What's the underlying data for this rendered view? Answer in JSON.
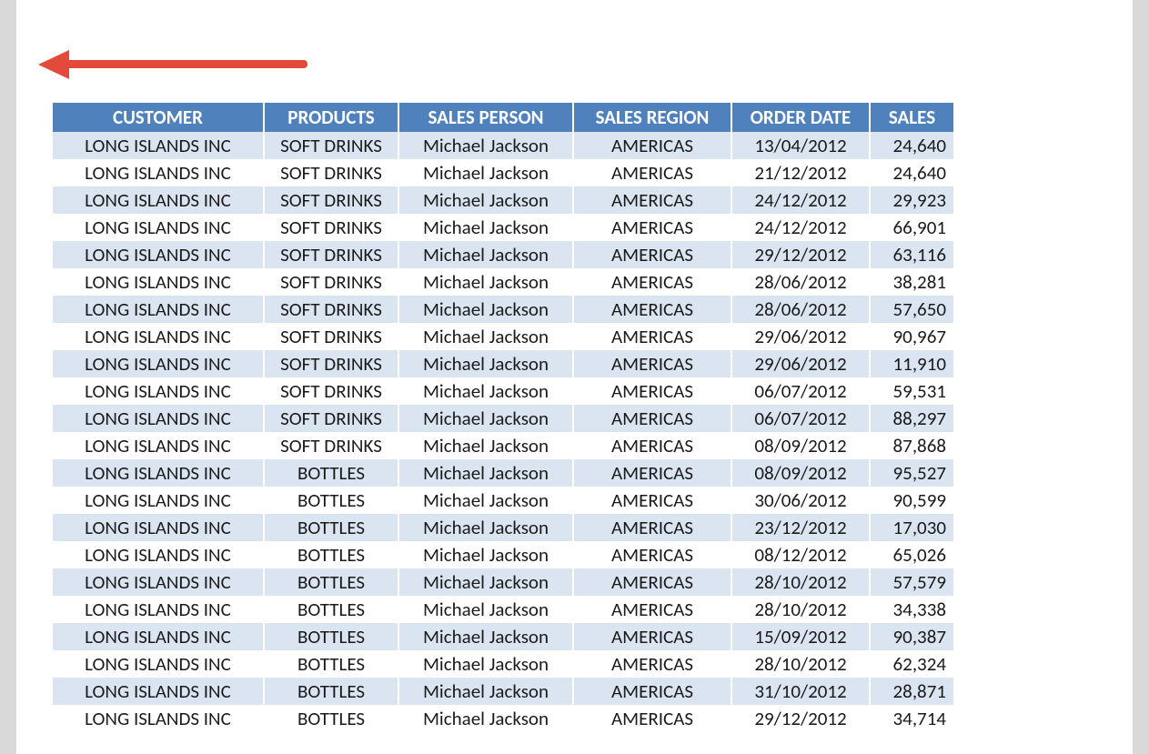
{
  "table": {
    "headers": [
      "CUSTOMER",
      "PRODUCTS",
      "SALES PERSON",
      "SALES REGION",
      "ORDER DATE",
      "SALES"
    ],
    "rows": [
      {
        "customer": "LONG ISLANDS INC",
        "product": "SOFT DRINKS",
        "person": "Michael Jackson",
        "region": "AMERICAS",
        "date": "13/04/2012",
        "sales": "24,640"
      },
      {
        "customer": "LONG ISLANDS INC",
        "product": "SOFT DRINKS",
        "person": "Michael Jackson",
        "region": "AMERICAS",
        "date": "21/12/2012",
        "sales": "24,640"
      },
      {
        "customer": "LONG ISLANDS INC",
        "product": "SOFT DRINKS",
        "person": "Michael Jackson",
        "region": "AMERICAS",
        "date": "24/12/2012",
        "sales": "29,923"
      },
      {
        "customer": "LONG ISLANDS INC",
        "product": "SOFT DRINKS",
        "person": "Michael Jackson",
        "region": "AMERICAS",
        "date": "24/12/2012",
        "sales": "66,901"
      },
      {
        "customer": "LONG ISLANDS INC",
        "product": "SOFT DRINKS",
        "person": "Michael Jackson",
        "region": "AMERICAS",
        "date": "29/12/2012",
        "sales": "63,116"
      },
      {
        "customer": "LONG ISLANDS INC",
        "product": "SOFT DRINKS",
        "person": "Michael Jackson",
        "region": "AMERICAS",
        "date": "28/06/2012",
        "sales": "38,281"
      },
      {
        "customer": "LONG ISLANDS INC",
        "product": "SOFT DRINKS",
        "person": "Michael Jackson",
        "region": "AMERICAS",
        "date": "28/06/2012",
        "sales": "57,650"
      },
      {
        "customer": "LONG ISLANDS INC",
        "product": "SOFT DRINKS",
        "person": "Michael Jackson",
        "region": "AMERICAS",
        "date": "29/06/2012",
        "sales": "90,967"
      },
      {
        "customer": "LONG ISLANDS INC",
        "product": "SOFT DRINKS",
        "person": "Michael Jackson",
        "region": "AMERICAS",
        "date": "29/06/2012",
        "sales": "11,910"
      },
      {
        "customer": "LONG ISLANDS INC",
        "product": "SOFT DRINKS",
        "person": "Michael Jackson",
        "region": "AMERICAS",
        "date": "06/07/2012",
        "sales": "59,531"
      },
      {
        "customer": "LONG ISLANDS INC",
        "product": "SOFT DRINKS",
        "person": "Michael Jackson",
        "region": "AMERICAS",
        "date": "06/07/2012",
        "sales": "88,297"
      },
      {
        "customer": "LONG ISLANDS INC",
        "product": "SOFT DRINKS",
        "person": "Michael Jackson",
        "region": "AMERICAS",
        "date": "08/09/2012",
        "sales": "87,868"
      },
      {
        "customer": "LONG ISLANDS INC",
        "product": "BOTTLES",
        "person": "Michael Jackson",
        "region": "AMERICAS",
        "date": "08/09/2012",
        "sales": "95,527"
      },
      {
        "customer": "LONG ISLANDS INC",
        "product": "BOTTLES",
        "person": "Michael Jackson",
        "region": "AMERICAS",
        "date": "30/06/2012",
        "sales": "90,599"
      },
      {
        "customer": "LONG ISLANDS INC",
        "product": "BOTTLES",
        "person": "Michael Jackson",
        "region": "AMERICAS",
        "date": "23/12/2012",
        "sales": "17,030"
      },
      {
        "customer": "LONG ISLANDS INC",
        "product": "BOTTLES",
        "person": "Michael Jackson",
        "region": "AMERICAS",
        "date": "08/12/2012",
        "sales": "65,026"
      },
      {
        "customer": "LONG ISLANDS INC",
        "product": "BOTTLES",
        "person": "Michael Jackson",
        "region": "AMERICAS",
        "date": "28/10/2012",
        "sales": "57,579"
      },
      {
        "customer": "LONG ISLANDS INC",
        "product": "BOTTLES",
        "person": "Michael Jackson",
        "region": "AMERICAS",
        "date": "28/10/2012",
        "sales": "34,338"
      },
      {
        "customer": "LONG ISLANDS INC",
        "product": "BOTTLES",
        "person": "Michael Jackson",
        "region": "AMERICAS",
        "date": "15/09/2012",
        "sales": "90,387"
      },
      {
        "customer": "LONG ISLANDS INC",
        "product": "BOTTLES",
        "person": "Michael Jackson",
        "region": "AMERICAS",
        "date": "28/10/2012",
        "sales": "62,324"
      },
      {
        "customer": "LONG ISLANDS INC",
        "product": "BOTTLES",
        "person": "Michael Jackson",
        "region": "AMERICAS",
        "date": "31/10/2012",
        "sales": "28,871"
      },
      {
        "customer": "LONG ISLANDS INC",
        "product": "BOTTLES",
        "person": "Michael Jackson",
        "region": "AMERICAS",
        "date": "29/12/2012",
        "sales": "34,714"
      }
    ]
  }
}
